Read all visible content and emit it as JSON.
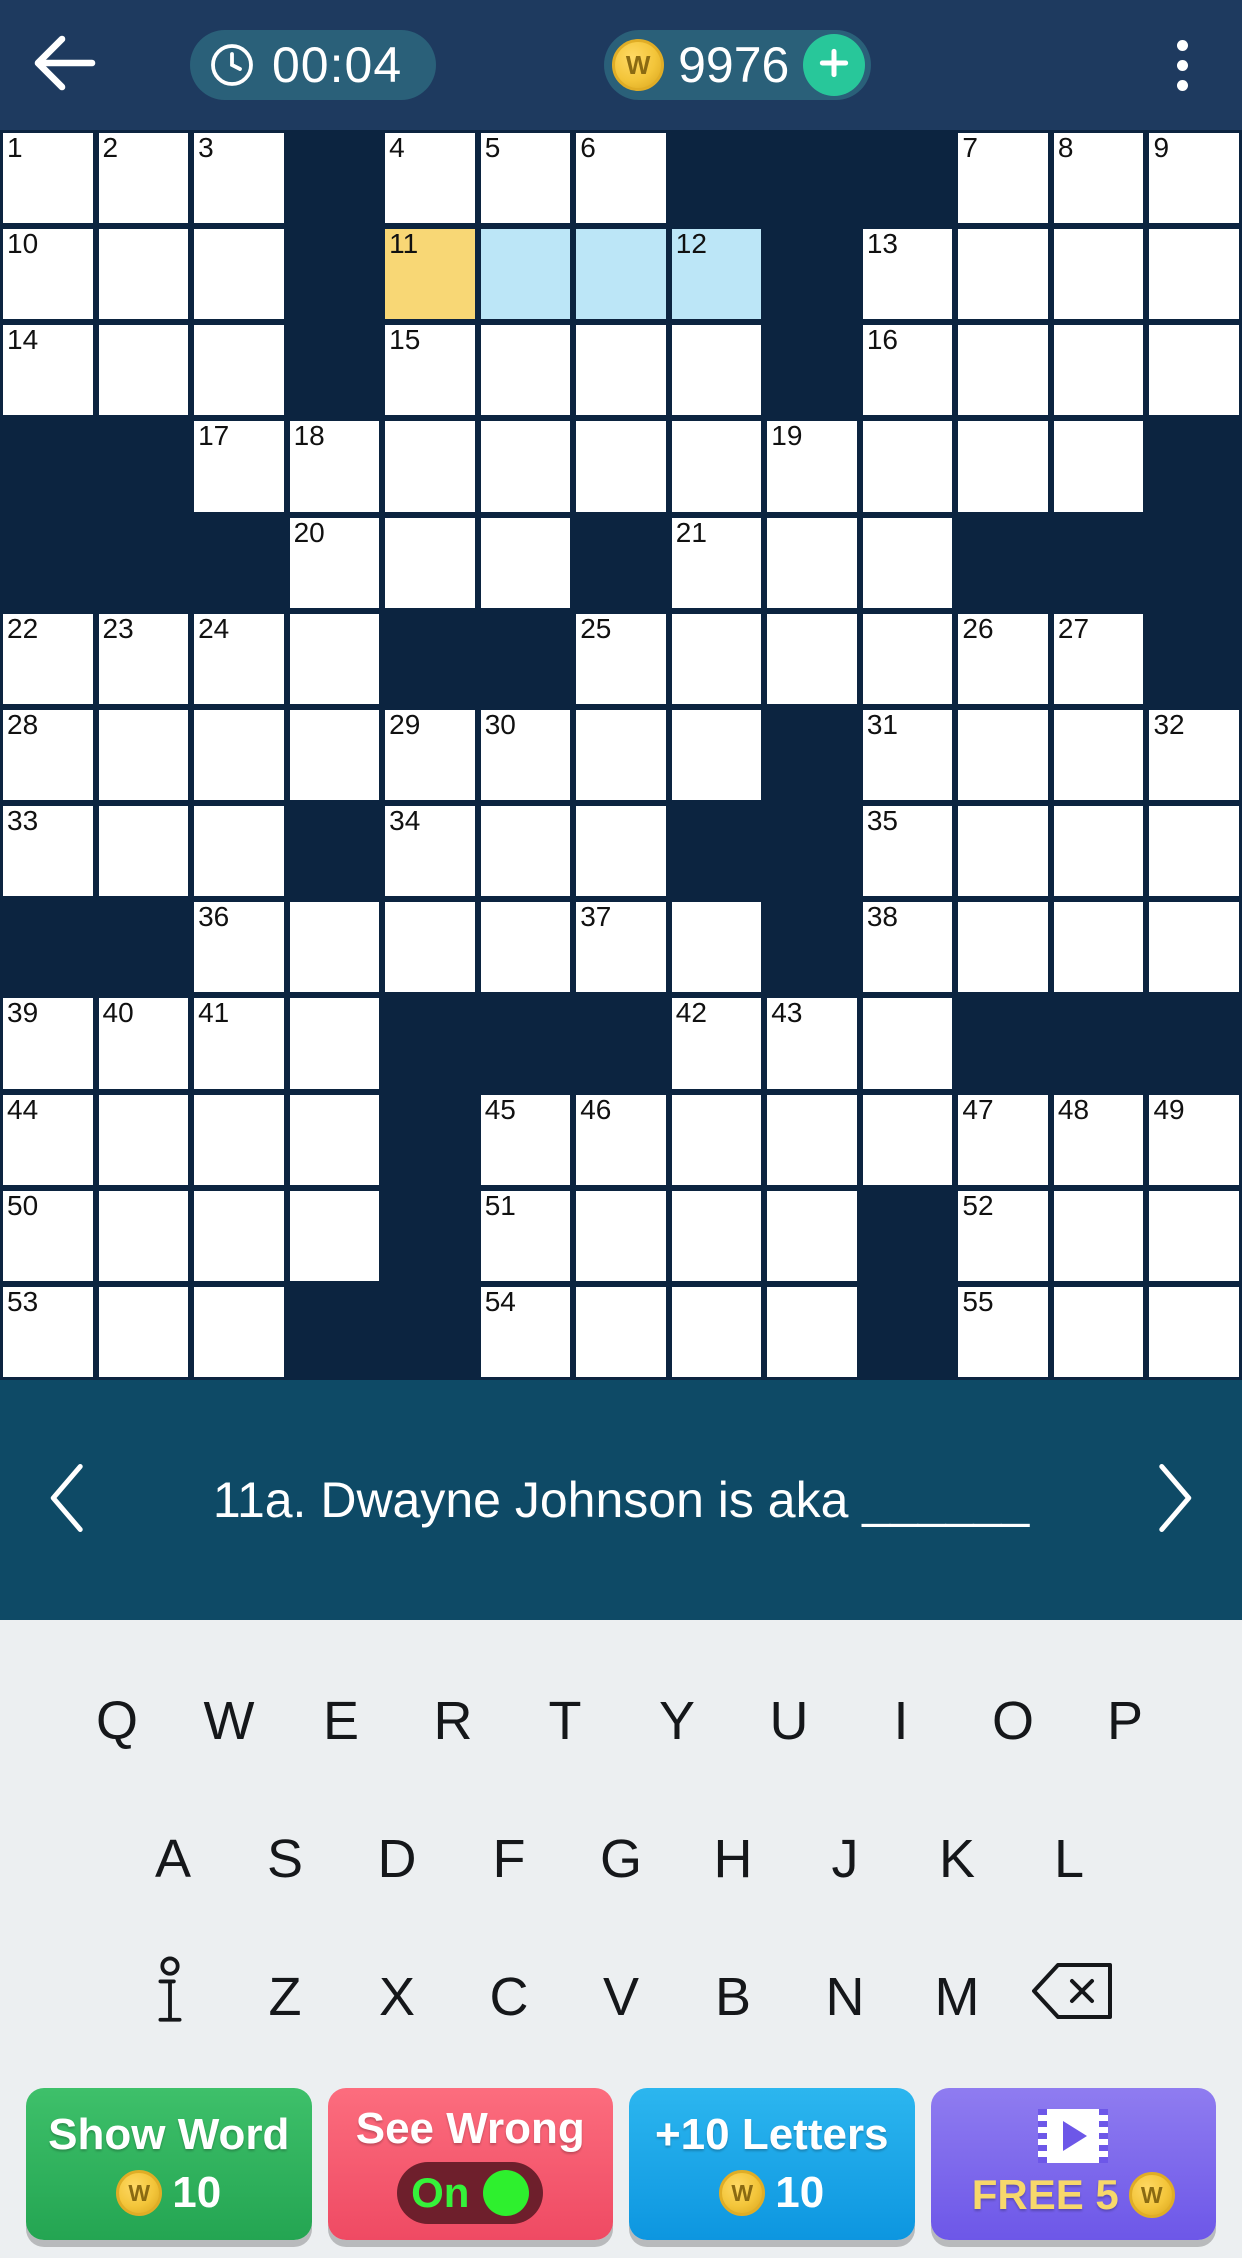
{
  "header": {
    "back_icon": "arrow-left-icon",
    "timer_icon": "clock-icon",
    "timer": "00:04",
    "coin_symbol": "W",
    "coin_count": "9976",
    "plus_icon": "plus-icon",
    "menu_icon": "overflow-menu-icon",
    "bar_color": "#1e3a5f",
    "pill_color": "#2a6079",
    "plus_color": "#28c79a"
  },
  "grid": {
    "columns": 13,
    "rows": 13,
    "block_color": "#0c2440",
    "cell_color": "#ffffff",
    "selected_color": "#f8d775",
    "highlight_color": "#bce6f7",
    "cells": [
      [
        {
          "t": "o",
          "n": "1"
        },
        {
          "t": "o",
          "n": "2"
        },
        {
          "t": "o",
          "n": "3"
        },
        {
          "t": "b"
        },
        {
          "t": "o",
          "n": "4"
        },
        {
          "t": "o",
          "n": "5"
        },
        {
          "t": "o",
          "n": "6"
        },
        {
          "t": "b"
        },
        {
          "t": "b"
        },
        {
          "t": "b"
        },
        {
          "t": "o",
          "n": "7"
        },
        {
          "t": "o",
          "n": "8"
        },
        {
          "t": "o",
          "n": "9"
        }
      ],
      [
        {
          "t": "o",
          "n": "10"
        },
        {
          "t": "o"
        },
        {
          "t": "o"
        },
        {
          "t": "b"
        },
        {
          "t": "s",
          "n": "11"
        },
        {
          "t": "h"
        },
        {
          "t": "h"
        },
        {
          "t": "h",
          "n": "12"
        },
        {
          "t": "b"
        },
        {
          "t": "o",
          "n": "13"
        },
        {
          "t": "o"
        },
        {
          "t": "o"
        },
        {
          "t": "o"
        }
      ],
      [
        {
          "t": "o",
          "n": "14"
        },
        {
          "t": "o"
        },
        {
          "t": "o"
        },
        {
          "t": "b"
        },
        {
          "t": "o",
          "n": "15"
        },
        {
          "t": "o"
        },
        {
          "t": "o"
        },
        {
          "t": "o"
        },
        {
          "t": "b"
        },
        {
          "t": "o",
          "n": "16"
        },
        {
          "t": "o"
        },
        {
          "t": "o"
        },
        {
          "t": "o"
        }
      ],
      [
        {
          "t": "b"
        },
        {
          "t": "b"
        },
        {
          "t": "o",
          "n": "17"
        },
        {
          "t": "o",
          "n": "18"
        },
        {
          "t": "o"
        },
        {
          "t": "o"
        },
        {
          "t": "o"
        },
        {
          "t": "o"
        },
        {
          "t": "o",
          "n": "19"
        },
        {
          "t": "o"
        },
        {
          "t": "o"
        },
        {
          "t": "o"
        },
        {
          "t": "b"
        }
      ],
      [
        {
          "t": "b"
        },
        {
          "t": "b"
        },
        {
          "t": "b"
        },
        {
          "t": "o",
          "n": "20"
        },
        {
          "t": "o"
        },
        {
          "t": "o"
        },
        {
          "t": "b"
        },
        {
          "t": "o",
          "n": "21"
        },
        {
          "t": "o"
        },
        {
          "t": "o"
        },
        {
          "t": "b"
        },
        {
          "t": "b"
        },
        {
          "t": "b"
        }
      ],
      [
        {
          "t": "o",
          "n": "22"
        },
        {
          "t": "o",
          "n": "23"
        },
        {
          "t": "o",
          "n": "24"
        },
        {
          "t": "o"
        },
        {
          "t": "b"
        },
        {
          "t": "b"
        },
        {
          "t": "o",
          "n": "25"
        },
        {
          "t": "o"
        },
        {
          "t": "o"
        },
        {
          "t": "o"
        },
        {
          "t": "o",
          "n": "26"
        },
        {
          "t": "o",
          "n": "27"
        },
        {
          "t": "b"
        }
      ],
      [
        {
          "t": "o",
          "n": "28"
        },
        {
          "t": "o"
        },
        {
          "t": "o"
        },
        {
          "t": "o"
        },
        {
          "t": "o",
          "n": "29"
        },
        {
          "t": "o",
          "n": "30"
        },
        {
          "t": "o"
        },
        {
          "t": "o"
        },
        {
          "t": "b"
        },
        {
          "t": "o",
          "n": "31"
        },
        {
          "t": "o"
        },
        {
          "t": "o"
        },
        {
          "t": "o",
          "n": "32"
        }
      ],
      [
        {
          "t": "o",
          "n": "33"
        },
        {
          "t": "o"
        },
        {
          "t": "o"
        },
        {
          "t": "b"
        },
        {
          "t": "o",
          "n": "34"
        },
        {
          "t": "o"
        },
        {
          "t": "o"
        },
        {
          "t": "b"
        },
        {
          "t": "b"
        },
        {
          "t": "o",
          "n": "35"
        },
        {
          "t": "o"
        },
        {
          "t": "o"
        },
        {
          "t": "o"
        }
      ],
      [
        {
          "t": "b"
        },
        {
          "t": "b"
        },
        {
          "t": "o",
          "n": "36"
        },
        {
          "t": "o"
        },
        {
          "t": "o"
        },
        {
          "t": "o"
        },
        {
          "t": "o",
          "n": "37"
        },
        {
          "t": "o"
        },
        {
          "t": "b"
        },
        {
          "t": "o",
          "n": "38"
        },
        {
          "t": "o"
        },
        {
          "t": "o"
        },
        {
          "t": "o"
        }
      ],
      [
        {
          "t": "o",
          "n": "39"
        },
        {
          "t": "o",
          "n": "40"
        },
        {
          "t": "o",
          "n": "41"
        },
        {
          "t": "o"
        },
        {
          "t": "b"
        },
        {
          "t": "b"
        },
        {
          "t": "b"
        },
        {
          "t": "o",
          "n": "42"
        },
        {
          "t": "o",
          "n": "43"
        },
        {
          "t": "o"
        },
        {
          "t": "b"
        },
        {
          "t": "b"
        },
        {
          "t": "b"
        }
      ],
      [
        {
          "t": "o",
          "n": "44"
        },
        {
          "t": "o"
        },
        {
          "t": "o"
        },
        {
          "t": "o"
        },
        {
          "t": "b"
        },
        {
          "t": "o",
          "n": "45"
        },
        {
          "t": "o",
          "n": "46"
        },
        {
          "t": "o"
        },
        {
          "t": "o"
        },
        {
          "t": "o"
        },
        {
          "t": "o",
          "n": "47"
        },
        {
          "t": "o",
          "n": "48"
        },
        {
          "t": "o",
          "n": "49"
        }
      ],
      [
        {
          "t": "o",
          "n": "50"
        },
        {
          "t": "o"
        },
        {
          "t": "o"
        },
        {
          "t": "o"
        },
        {
          "t": "b"
        },
        {
          "t": "o",
          "n": "51"
        },
        {
          "t": "o"
        },
        {
          "t": "o"
        },
        {
          "t": "o"
        },
        {
          "t": "b"
        },
        {
          "t": "o",
          "n": "52"
        },
        {
          "t": "o"
        },
        {
          "t": "o"
        }
      ],
      [
        {
          "t": "o",
          "n": "53"
        },
        {
          "t": "o"
        },
        {
          "t": "o"
        },
        {
          "t": "b"
        },
        {
          "t": "b"
        },
        {
          "t": "o",
          "n": "54"
        },
        {
          "t": "o"
        },
        {
          "t": "o"
        },
        {
          "t": "o"
        },
        {
          "t": "b"
        },
        {
          "t": "o",
          "n": "55"
        },
        {
          "t": "o"
        },
        {
          "t": "o"
        }
      ]
    ]
  },
  "clue": {
    "prev_icon": "chevron-left-icon",
    "next_icon": "chevron-right-icon",
    "text": "11a. Dwayne Johnson is aka ______",
    "bar_color": "#0e4a66"
  },
  "keyboard": {
    "row1": [
      "Q",
      "W",
      "E",
      "R",
      "T",
      "Y",
      "U",
      "I",
      "O",
      "P"
    ],
    "row2": [
      "A",
      "S",
      "D",
      "F",
      "G",
      "H",
      "J",
      "K",
      "L"
    ],
    "row3": [
      "Z",
      "X",
      "C",
      "V",
      "B",
      "N",
      "M"
    ],
    "info_icon": "info-icon",
    "backspace_icon": "backspace-icon",
    "background": "#eceff1"
  },
  "actions": [
    {
      "id": "show-word",
      "label": "Show Word",
      "cost": "10",
      "coin": "W",
      "color": "#2fae5e"
    },
    {
      "id": "see-wrong",
      "label": "See Wrong",
      "toggle": "On",
      "color": "#ef4a63"
    },
    {
      "id": "plus-letters",
      "label": "+10 Letters",
      "cost": "10",
      "coin": "W",
      "color": "#0d96e0"
    },
    {
      "id": "free-coins",
      "label": "FREE 5",
      "coin": "W",
      "icon": "video-icon",
      "color": "#6d57e8"
    }
  ]
}
